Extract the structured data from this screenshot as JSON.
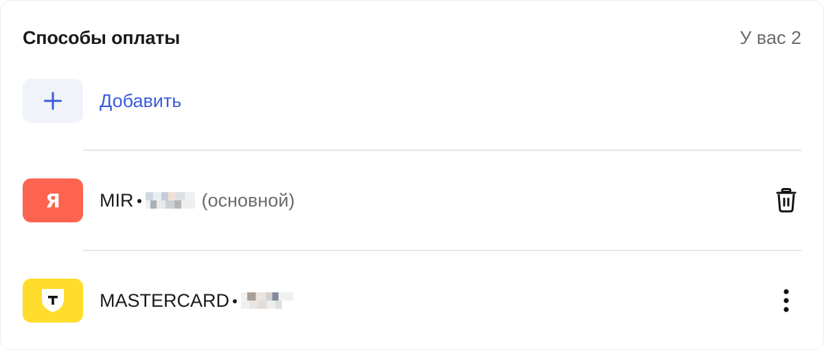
{
  "header": {
    "title": "Способы оплаты",
    "count_text": "У вас 2"
  },
  "add": {
    "label": "Добавить",
    "icon": "plus-icon"
  },
  "cards": [
    {
      "network": "MIR",
      "suffix": "(основной)",
      "bank_icon": "yandex-logo-icon",
      "bank_letter": "Я",
      "action_icon": "trash-icon"
    },
    {
      "network": "MASTERCARD",
      "suffix": "",
      "bank_icon": "tbank-logo-icon",
      "action_icon": "more-vertical-icon"
    }
  ],
  "colors": {
    "accent": "#3b5bdb",
    "yandex": "#fc6450",
    "tbank": "#ffdd2d"
  }
}
